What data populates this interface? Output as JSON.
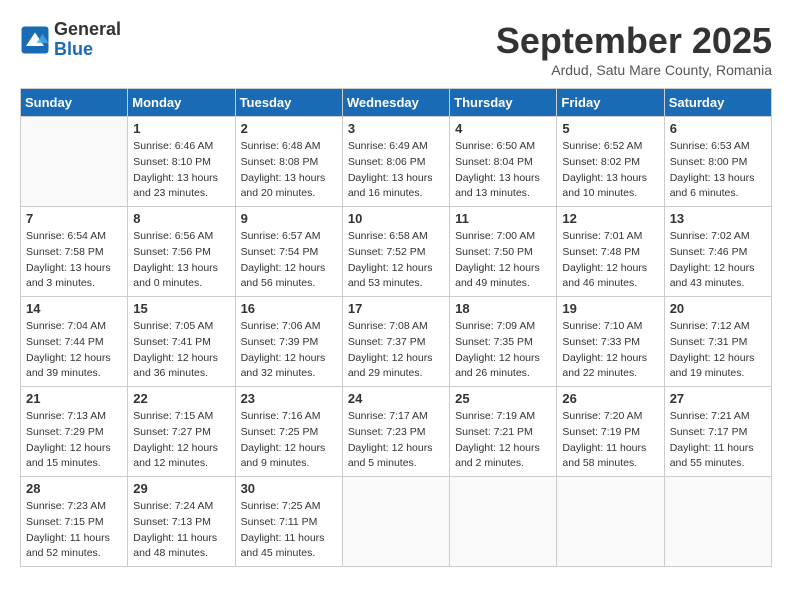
{
  "logo": {
    "general": "General",
    "blue": "Blue"
  },
  "title": "September 2025",
  "subtitle": "Ardud, Satu Mare County, Romania",
  "weekdays": [
    "Sunday",
    "Monday",
    "Tuesday",
    "Wednesday",
    "Thursday",
    "Friday",
    "Saturday"
  ],
  "weeks": [
    [
      {
        "day": "",
        "info": ""
      },
      {
        "day": "1",
        "info": "Sunrise: 6:46 AM\nSunset: 8:10 PM\nDaylight: 13 hours\nand 23 minutes."
      },
      {
        "day": "2",
        "info": "Sunrise: 6:48 AM\nSunset: 8:08 PM\nDaylight: 13 hours\nand 20 minutes."
      },
      {
        "day": "3",
        "info": "Sunrise: 6:49 AM\nSunset: 8:06 PM\nDaylight: 13 hours\nand 16 minutes."
      },
      {
        "day": "4",
        "info": "Sunrise: 6:50 AM\nSunset: 8:04 PM\nDaylight: 13 hours\nand 13 minutes."
      },
      {
        "day": "5",
        "info": "Sunrise: 6:52 AM\nSunset: 8:02 PM\nDaylight: 13 hours\nand 10 minutes."
      },
      {
        "day": "6",
        "info": "Sunrise: 6:53 AM\nSunset: 8:00 PM\nDaylight: 13 hours\nand 6 minutes."
      }
    ],
    [
      {
        "day": "7",
        "info": "Sunrise: 6:54 AM\nSunset: 7:58 PM\nDaylight: 13 hours\nand 3 minutes."
      },
      {
        "day": "8",
        "info": "Sunrise: 6:56 AM\nSunset: 7:56 PM\nDaylight: 13 hours\nand 0 minutes."
      },
      {
        "day": "9",
        "info": "Sunrise: 6:57 AM\nSunset: 7:54 PM\nDaylight: 12 hours\nand 56 minutes."
      },
      {
        "day": "10",
        "info": "Sunrise: 6:58 AM\nSunset: 7:52 PM\nDaylight: 12 hours\nand 53 minutes."
      },
      {
        "day": "11",
        "info": "Sunrise: 7:00 AM\nSunset: 7:50 PM\nDaylight: 12 hours\nand 49 minutes."
      },
      {
        "day": "12",
        "info": "Sunrise: 7:01 AM\nSunset: 7:48 PM\nDaylight: 12 hours\nand 46 minutes."
      },
      {
        "day": "13",
        "info": "Sunrise: 7:02 AM\nSunset: 7:46 PM\nDaylight: 12 hours\nand 43 minutes."
      }
    ],
    [
      {
        "day": "14",
        "info": "Sunrise: 7:04 AM\nSunset: 7:44 PM\nDaylight: 12 hours\nand 39 minutes."
      },
      {
        "day": "15",
        "info": "Sunrise: 7:05 AM\nSunset: 7:41 PM\nDaylight: 12 hours\nand 36 minutes."
      },
      {
        "day": "16",
        "info": "Sunrise: 7:06 AM\nSunset: 7:39 PM\nDaylight: 12 hours\nand 32 minutes."
      },
      {
        "day": "17",
        "info": "Sunrise: 7:08 AM\nSunset: 7:37 PM\nDaylight: 12 hours\nand 29 minutes."
      },
      {
        "day": "18",
        "info": "Sunrise: 7:09 AM\nSunset: 7:35 PM\nDaylight: 12 hours\nand 26 minutes."
      },
      {
        "day": "19",
        "info": "Sunrise: 7:10 AM\nSunset: 7:33 PM\nDaylight: 12 hours\nand 22 minutes."
      },
      {
        "day": "20",
        "info": "Sunrise: 7:12 AM\nSunset: 7:31 PM\nDaylight: 12 hours\nand 19 minutes."
      }
    ],
    [
      {
        "day": "21",
        "info": "Sunrise: 7:13 AM\nSunset: 7:29 PM\nDaylight: 12 hours\nand 15 minutes."
      },
      {
        "day": "22",
        "info": "Sunrise: 7:15 AM\nSunset: 7:27 PM\nDaylight: 12 hours\nand 12 minutes."
      },
      {
        "day": "23",
        "info": "Sunrise: 7:16 AM\nSunset: 7:25 PM\nDaylight: 12 hours\nand 9 minutes."
      },
      {
        "day": "24",
        "info": "Sunrise: 7:17 AM\nSunset: 7:23 PM\nDaylight: 12 hours\nand 5 minutes."
      },
      {
        "day": "25",
        "info": "Sunrise: 7:19 AM\nSunset: 7:21 PM\nDaylight: 12 hours\nand 2 minutes."
      },
      {
        "day": "26",
        "info": "Sunrise: 7:20 AM\nSunset: 7:19 PM\nDaylight: 11 hours\nand 58 minutes."
      },
      {
        "day": "27",
        "info": "Sunrise: 7:21 AM\nSunset: 7:17 PM\nDaylight: 11 hours\nand 55 minutes."
      }
    ],
    [
      {
        "day": "28",
        "info": "Sunrise: 7:23 AM\nSunset: 7:15 PM\nDaylight: 11 hours\nand 52 minutes."
      },
      {
        "day": "29",
        "info": "Sunrise: 7:24 AM\nSunset: 7:13 PM\nDaylight: 11 hours\nand 48 minutes."
      },
      {
        "day": "30",
        "info": "Sunrise: 7:25 AM\nSunset: 7:11 PM\nDaylight: 11 hours\nand 45 minutes."
      },
      {
        "day": "",
        "info": ""
      },
      {
        "day": "",
        "info": ""
      },
      {
        "day": "",
        "info": ""
      },
      {
        "day": "",
        "info": ""
      }
    ]
  ]
}
